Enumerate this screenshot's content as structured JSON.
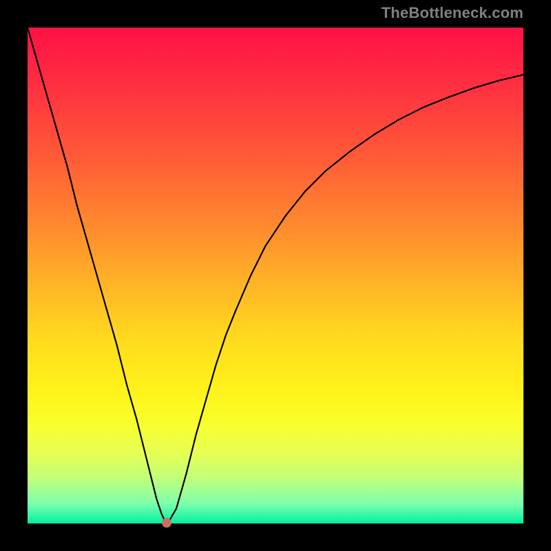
{
  "watermark": "TheBottleneck.com",
  "colors": {
    "curve_stroke": "#000000",
    "marker_fill": "#cc6f63",
    "frame": "#000000"
  },
  "chart_data": {
    "type": "line",
    "title": "",
    "xlabel": "",
    "ylabel": "",
    "xlim": [
      0,
      100
    ],
    "ylim": [
      0,
      100
    ],
    "grid": false,
    "legend": false,
    "series": [
      {
        "name": "bottleneck_curve",
        "x": [
          0,
          2,
          4,
          6,
          8,
          10,
          12,
          14,
          16,
          18,
          20,
          22,
          24,
          25,
          26,
          27,
          27.6,
          28.6,
          30,
          32,
          34,
          36,
          38,
          40,
          42,
          45,
          48,
          52,
          56,
          60,
          65,
          70,
          75,
          80,
          85,
          90,
          95,
          100
        ],
        "y": [
          100,
          93,
          86,
          79,
          72,
          64,
          57,
          50,
          43,
          36,
          28,
          21,
          13,
          9,
          5,
          2,
          0.7,
          0.6,
          3,
          10,
          18,
          25,
          32,
          38,
          43,
          50,
          56,
          62,
          67,
          71,
          75,
          78.5,
          81.5,
          84,
          86,
          87.8,
          89.3,
          90.5
        ]
      }
    ],
    "marker": {
      "x": 28,
      "y": 0.2,
      "label": ""
    },
    "background_gradient": {
      "direction": "vertical",
      "stops": [
        {
          "pos": 0.0,
          "color": "#ff1146"
        },
        {
          "pos": 0.26,
          "color": "#ff5a37"
        },
        {
          "pos": 0.52,
          "color": "#ffb526"
        },
        {
          "pos": 0.73,
          "color": "#fff21a"
        },
        {
          "pos": 0.91,
          "color": "#c0ff7c"
        },
        {
          "pos": 1.0,
          "color": "#00f0a0"
        }
      ]
    }
  }
}
